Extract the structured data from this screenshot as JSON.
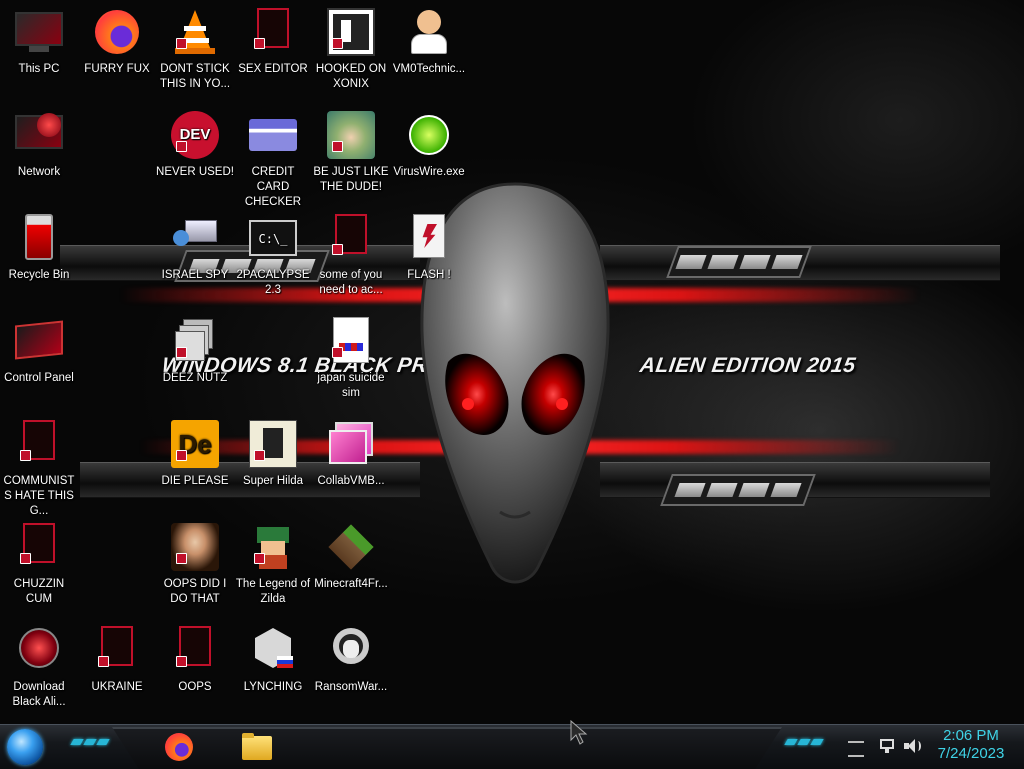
{
  "desktop": {
    "icons": [
      {
        "id": "this-pc",
        "label": "This PC"
      },
      {
        "id": "network",
        "label": "Network"
      },
      {
        "id": "recycle-bin",
        "label": "Recycle Bin"
      },
      {
        "id": "control-panel",
        "label": "Control Panel"
      },
      {
        "id": "communists",
        "label": "COMMUNISTS HATE THIS G..."
      },
      {
        "id": "chuzzin",
        "label": "CHUZZIN CUM"
      },
      {
        "id": "download-black-ali",
        "label": "Download Black Ali..."
      },
      {
        "id": "furry-fux",
        "label": "FURRY FUX"
      },
      {
        "id": "ukraine",
        "label": "UKRAINE"
      },
      {
        "id": "dont-stick",
        "label": "DONT STICK THIS IN YO..."
      },
      {
        "id": "never-used",
        "label": "NEVER USED!"
      },
      {
        "id": "israel-spy",
        "label": "ISRAEL SPY"
      },
      {
        "id": "deez-nutz",
        "label": "DEEZ NUTZ"
      },
      {
        "id": "die-please",
        "label": "DIE PLEASE"
      },
      {
        "id": "oops-did-i",
        "label": "OOPS DID I DO THAT"
      },
      {
        "id": "oops",
        "label": "OOPS"
      },
      {
        "id": "sex-editor",
        "label": "SEX EDITOR"
      },
      {
        "id": "credit-card",
        "label": "CREDIT CARD CHECKER"
      },
      {
        "id": "2pacalypse",
        "label": "2PACALYPSE 2.3"
      },
      {
        "id": "super-hilda",
        "label": "Super Hilda"
      },
      {
        "id": "legend-zilda",
        "label": "The Legend of Zilda"
      },
      {
        "id": "lynching",
        "label": "LYNCHING"
      },
      {
        "id": "hooked-xonix",
        "label": "HOOKED ON XONIX"
      },
      {
        "id": "be-just-like",
        "label": "BE JUST LIKE THE DUDE!"
      },
      {
        "id": "some-of-you",
        "label": "some of you need to ac..."
      },
      {
        "id": "japan-suicide",
        "label": "japan suicide sim"
      },
      {
        "id": "collabvmb",
        "label": "CollabVMB..."
      },
      {
        "id": "minecraft",
        "label": "Minecraft4Fr..."
      },
      {
        "id": "ransomware",
        "label": "RansomWar..."
      },
      {
        "id": "vm0technic",
        "label": "VM0Technic..."
      },
      {
        "id": "viruswire",
        "label": "VirusWire.exe"
      },
      {
        "id": "flash",
        "label": "FLASH !"
      }
    ]
  },
  "wallpaper": {
    "left_text": "WINDOWS 8.1 BLACK PRO",
    "right_text": "ALIEN EDITION 2015"
  },
  "taskbar": {
    "apps": [
      {
        "name": "firefox-icon"
      },
      {
        "name": "file-explorer-icon"
      }
    ],
    "time": "2:06 PM",
    "date": "7/24/2023",
    "tray_icons": [
      "network-icon",
      "volume-icon"
    ]
  },
  "colors": {
    "accent": "#3fd3e6",
    "alien_eye": "#ff1a1a",
    "band_red": "#e61414"
  }
}
